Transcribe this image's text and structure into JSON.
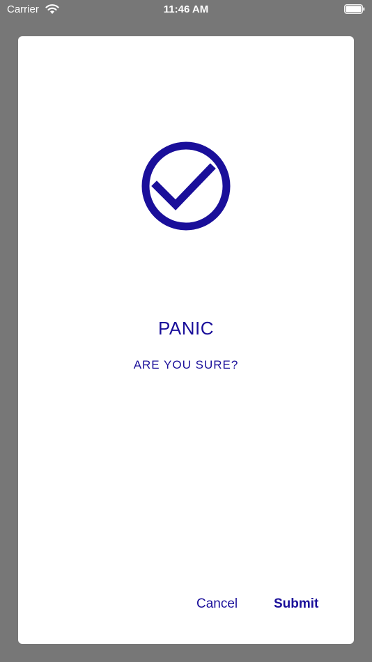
{
  "status_bar": {
    "carrier": "Carrier",
    "time": "11:46 AM",
    "icons": [
      "wifi-icon",
      "battery-icon"
    ]
  },
  "dialog": {
    "icon": "check-circle-icon",
    "title": "PANIC",
    "subtitle": "ARE YOU SURE?",
    "cancel_label": "Cancel",
    "submit_label": "Submit"
  },
  "colors": {
    "accent": "#1a0f9a",
    "overlay": "#777777",
    "dialog_bg": "#ffffff"
  }
}
